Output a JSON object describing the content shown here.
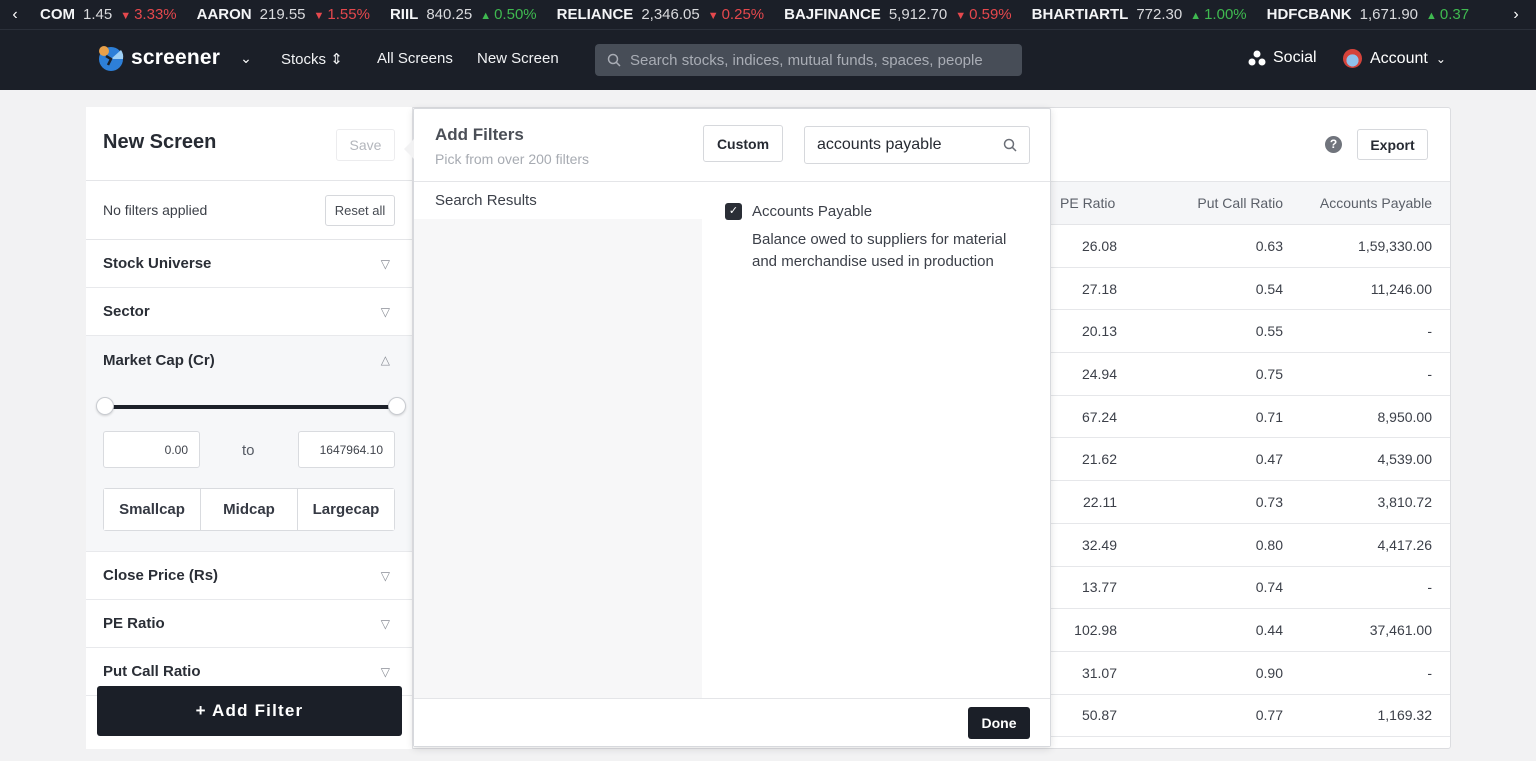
{
  "ticker": {
    "items": [
      {
        "symbol": "COM",
        "price": "1.45",
        "change": "3.33%",
        "direction": "down"
      },
      {
        "symbol": "AARON",
        "price": "219.55",
        "change": "1.55%",
        "direction": "down"
      },
      {
        "symbol": "RIIL",
        "price": "840.25",
        "change": "0.50%",
        "direction": "up"
      },
      {
        "symbol": "RELIANCE",
        "price": "2,346.05",
        "change": "0.25%",
        "direction": "down"
      },
      {
        "symbol": "BAJFINANCE",
        "price": "5,912.70",
        "change": "0.59%",
        "direction": "down"
      },
      {
        "symbol": "BHARTIARTL",
        "price": "772.30",
        "change": "1.00%",
        "direction": "up"
      },
      {
        "symbol": "HDFCBANK",
        "price": "1,671.90",
        "change": "0.37",
        "direction": "up"
      }
    ],
    "prev_icon": "‹",
    "next_icon": "›"
  },
  "nav": {
    "brand": "screener",
    "links": [
      "Stocks",
      "All Screens",
      "New Screen"
    ],
    "stocks_icon": "⇕",
    "search_placeholder": "Search stocks, indices, mutual funds, spaces, people",
    "social": "Social",
    "account": "Account"
  },
  "screen": {
    "title": "New Screen",
    "save_label": "Save",
    "status": "No filters applied",
    "reset_label": "Reset all",
    "filters": [
      {
        "label": "Stock Universe",
        "open": false
      },
      {
        "label": "Sector",
        "open": false
      },
      {
        "label": "Market Cap (Cr)",
        "open": true
      },
      {
        "label": "Close Price (Rs)",
        "open": false
      },
      {
        "label": "PE Ratio",
        "open": false
      },
      {
        "label": "Put Call Ratio",
        "open": false
      }
    ],
    "market_cap": {
      "min": "0.00",
      "max": "1647964.10",
      "to_label": "to",
      "slider_low_fraction": 0,
      "slider_high_fraction": 1,
      "presets": [
        "Smallcap",
        "Midcap",
        "Largecap"
      ]
    },
    "add_filter_label": "+  Add Filter"
  },
  "modal": {
    "title": "Add Filters",
    "subtitle": "Pick from over 200 filters",
    "custom_label": "Custom",
    "search_value": "accounts payable",
    "category": "Search Results",
    "results": [
      {
        "label": "Accounts Payable",
        "checked": true,
        "description": "Balance owed to suppliers for material and merchandise used in production"
      }
    ],
    "done_label": "Done"
  },
  "results_table": {
    "export_label": "Export",
    "help_icon": "?",
    "columns": [
      "PE Ratio",
      "Put Call Ratio",
      "Accounts Payable"
    ],
    "rows": [
      [
        "26.08",
        "0.63",
        "1,59,330.00"
      ],
      [
        "27.18",
        "0.54",
        "11,246.00"
      ],
      [
        "20.13",
        "0.55",
        "-"
      ],
      [
        "24.94",
        "0.75",
        "-"
      ],
      [
        "67.24",
        "0.71",
        "8,950.00"
      ],
      [
        "21.62",
        "0.47",
        "4,539.00"
      ],
      [
        "22.11",
        "0.73",
        "3,810.72"
      ],
      [
        "32.49",
        "0.80",
        "4,417.26"
      ],
      [
        "13.77",
        "0.74",
        "-"
      ],
      [
        "102.98",
        "0.44",
        "37,461.00"
      ],
      [
        "31.07",
        "0.90",
        "-"
      ],
      [
        "50.87",
        "0.77",
        "1,169.32"
      ]
    ]
  }
}
